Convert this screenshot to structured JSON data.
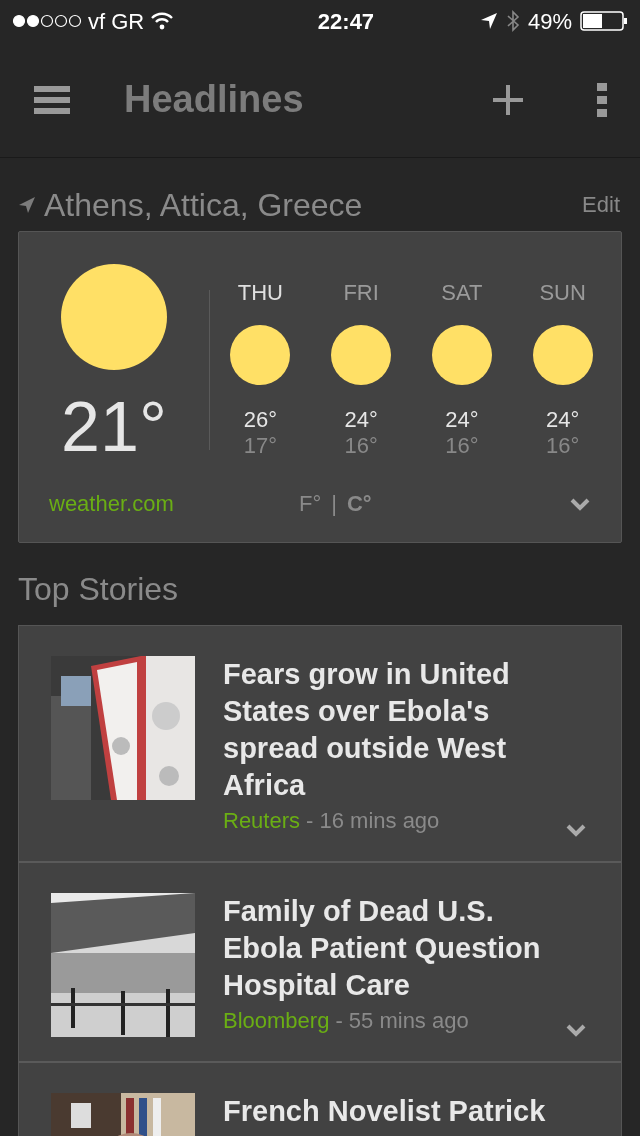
{
  "status_bar": {
    "carrier": "vf GR",
    "time": "22:47",
    "battery": "49%"
  },
  "toolbar": {
    "title": "Headlines"
  },
  "weather": {
    "location": "Athens, Attica, Greece",
    "edit": "Edit",
    "current_temp": "21°",
    "source": "weather.com",
    "forecast": [
      {
        "day": "THU",
        "high": "26°",
        "low": "17°",
        "selected": true
      },
      {
        "day": "FRI",
        "high": "24°",
        "low": "16°",
        "selected": false
      },
      {
        "day": "SAT",
        "high": "24°",
        "low": "16°",
        "selected": false
      },
      {
        "day": "SUN",
        "high": "24°",
        "low": "16°",
        "selected": false
      }
    ],
    "units": [
      {
        "label": "F°",
        "selected": false
      },
      {
        "label": "C°",
        "selected": true
      }
    ],
    "separator": "|"
  },
  "section_title": "Top Stories",
  "stories": [
    {
      "title": "Fears grow in United States over Ebola's spread outside West Africa",
      "source": "Reuters",
      "time": "- 16 mins ago"
    },
    {
      "title": "Family of Dead U.S. Ebola Patient Question Hospital Care",
      "source": "Bloomberg",
      "time": "- 55 mins ago"
    },
    {
      "title": "French Novelist Patrick"
    }
  ]
}
